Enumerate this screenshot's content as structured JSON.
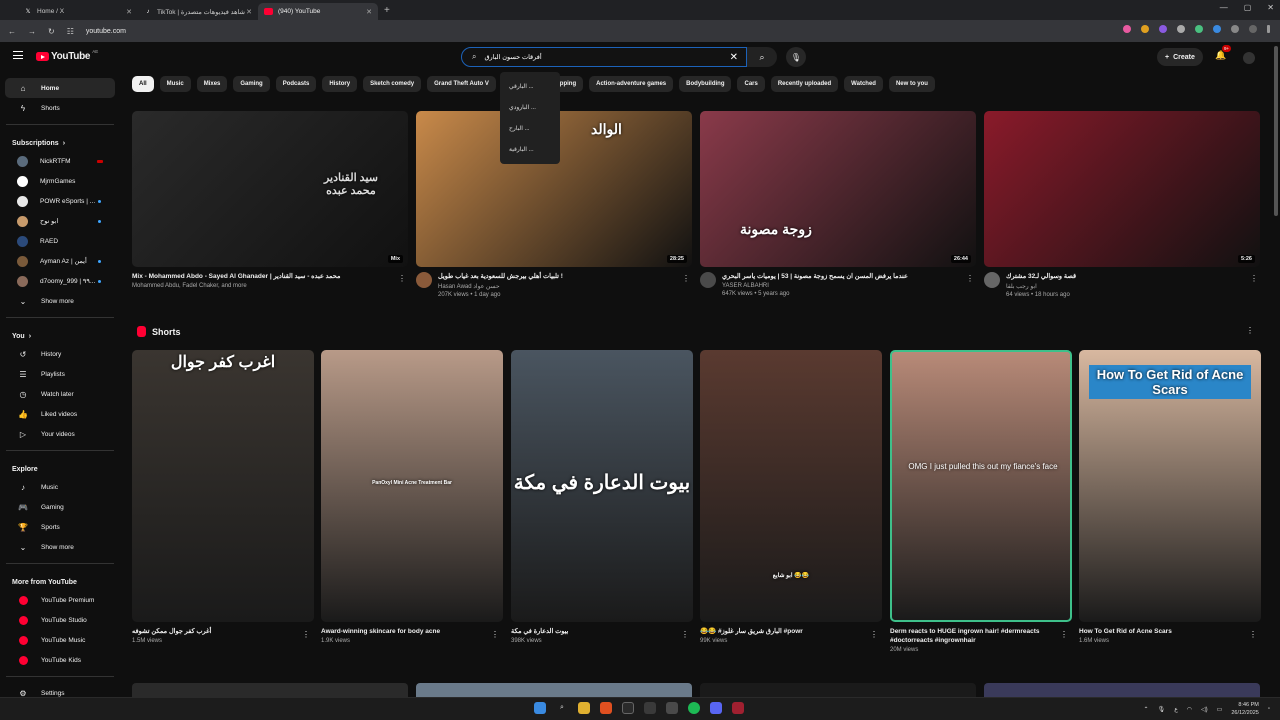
{
  "browser": {
    "tabs": [
      {
        "label": "Home / X",
        "icon": "x-icon"
      },
      {
        "label": "TikTok | شاهد فيديوهات متصدرة",
        "icon": "tiktok-icon"
      },
      {
        "label": "(940) YouTube",
        "icon": "youtube-icon"
      }
    ],
    "url": "youtube.com"
  },
  "header": {
    "logo_text": "YouTube",
    "country": "AE",
    "search_value": "أفرقات حسون البارق",
    "create_label": "Create",
    "notifications": "9+"
  },
  "search_suggestions": [
    "البارقي ...",
    "البارودي ...",
    "البارح ...",
    "البارقية ..."
  ],
  "sidebar": {
    "top": [
      {
        "label": "Home",
        "icon": "home-icon"
      },
      {
        "label": "Shorts",
        "icon": "shorts-icon"
      }
    ],
    "subscriptions_title": "Subscriptions",
    "subscriptions": [
      {
        "label": "NickRTFM",
        "color": "#5a6b7c",
        "badge": "live"
      },
      {
        "label": "MjrmGames",
        "color": "#ffffff",
        "badge": "none"
      },
      {
        "label": "POWR eSports | ...",
        "color": "#e8e8e8",
        "badge": "dot"
      },
      {
        "label": "ابو نوح",
        "color": "#c79a6b",
        "badge": "dot"
      },
      {
        "label": "RAED",
        "color": "#2b4a7a",
        "badge": "none"
      },
      {
        "label": "Ayman Az | أيمن",
        "color": "#7a5a3a",
        "badge": "dot"
      },
      {
        "label": "d7oomy_999 | ٩٩...",
        "color": "#8a6a5a",
        "badge": "dot"
      }
    ],
    "show_more": "Show more",
    "you_title": "You",
    "you": [
      {
        "label": "History",
        "icon": "history-icon"
      },
      {
        "label": "Playlists",
        "icon": "playlists-icon"
      },
      {
        "label": "Watch later",
        "icon": "watch-later-icon"
      },
      {
        "label": "Liked videos",
        "icon": "like-icon"
      },
      {
        "label": "Your videos",
        "icon": "your-videos-icon"
      }
    ],
    "explore_title": "Explore",
    "explore": [
      {
        "label": "Music",
        "icon": "music-icon"
      },
      {
        "label": "Gaming",
        "icon": "gaming-icon"
      },
      {
        "label": "Sports",
        "icon": "sports-icon"
      },
      {
        "label": "Show more",
        "icon": "chevron-down-icon"
      }
    ],
    "more_title": "More from YouTube",
    "more": [
      {
        "label": "YouTube Premium"
      },
      {
        "label": "YouTube Studio"
      },
      {
        "label": "YouTube Music"
      },
      {
        "label": "YouTube Kids"
      }
    ],
    "settings": "Settings"
  },
  "chips": [
    "All",
    "Music",
    "Mixes",
    "Gaming",
    "Podcasts",
    "History",
    "Sketch comedy",
    "Grand Theft Auto V",
    "Tourism",
    "Rapping",
    "Action-adventure games",
    "Bodybuilding",
    "Cars",
    "Recently uploaded",
    "Watched",
    "New to you"
  ],
  "videos": [
    {
      "title": "Mix - Mohammed Abdo - Sayed Al Ghanader | محمد عبده - سيد القنادير",
      "channel": "Mohammed Abdu, Fadel Chaker, and more",
      "stats": "",
      "duration": "Mix",
      "thumb_text": "سيد القنادير\nمحمد عبده",
      "thumb_color": "#2a2a2a",
      "avatar_color": "#444444"
    },
    {
      "title": "تلبيات أهلي بيرجش للسعودية بعد غياب طويل !",
      "channel": "Hasan Awad حسن عواد",
      "stats": "207K views • 1 day ago",
      "duration": "28:25",
      "thumb_text": "الوالد",
      "thumb_color": "#c98a4a",
      "avatar_color": "#8a5a3a"
    },
    {
      "title": "عندما يرفض المسن ان يسمح زوجة مصونة | 53 | يوميات ياسر البحري",
      "channel": "YASER ALBAHRI",
      "stats": "647K views • 5 years ago",
      "duration": "26:44",
      "thumb_text": "زوجة مصونة",
      "thumb_color": "#8a3a4a",
      "avatar_color": "#4a4a4a"
    },
    {
      "title": "قصة وسوالي لـ32 مشترك",
      "channel": "ابو رجب بلقا",
      "stats": "64 views • 18 hours ago",
      "duration": "5:26",
      "thumb_text": "",
      "thumb_color": "#8a1a2a",
      "avatar_color": "#666666"
    }
  ],
  "shorts_title": "Shorts",
  "shorts": [
    {
      "title": "أغرب كفر جوال ممكن تشوفه",
      "views": "1.5M views",
      "overlay": "اغرب كفر جوال",
      "color": "#3a3530"
    },
    {
      "title": "Award-winning skincare for body acne",
      "views": "1.9K views",
      "overlay": "PanOxyl Mini Acne Treatment Bar",
      "color": "#b89a88"
    },
    {
      "title": "بيوت الدعارة في مكة",
      "views": "398K views",
      "overlay": "بيوت الدعارة في مكة",
      "color": "#4a5560"
    },
    {
      "title": "😂😂 #البارق شريق سار غلوز #powr",
      "views": "99K views",
      "overlay": "ابو شايع 😂😂",
      "color": "#5a3a30"
    },
    {
      "title": "Derm reacts to HUGE ingrown hair! #dermreacts #doctorreacts #ingrownhair",
      "views": "20M views",
      "overlay": "OMG I just pulled this out my fiance's face",
      "color": "#b88a78"
    },
    {
      "title": "How To Get Rid of Acne Scars",
      "views": "1.6M views",
      "overlay": "How To Get Rid of Acne Scars",
      "color": "#d8b8a0"
    }
  ],
  "taskbar": {
    "time": "8:46 PM",
    "date": "26/12/2025",
    "lang": "ع"
  }
}
